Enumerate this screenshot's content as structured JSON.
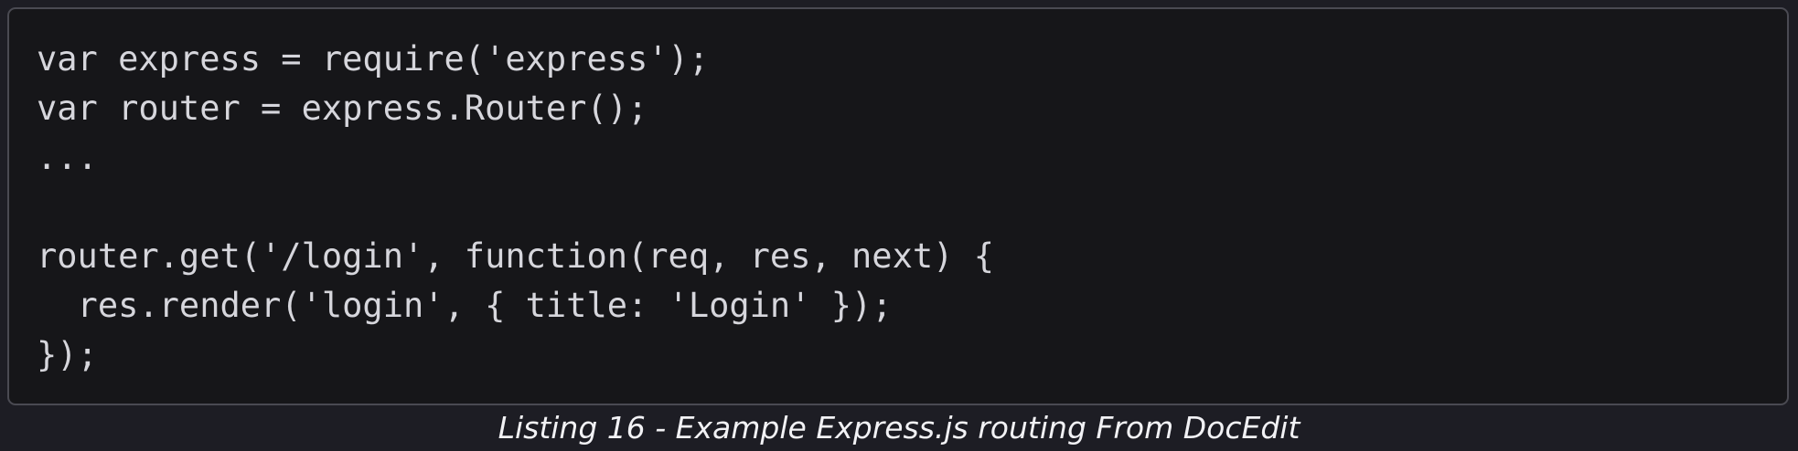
{
  "code": {
    "lines": [
      "var express = require('express');",
      "var router = express.Router();",
      "...",
      "",
      "router.get('/login', function(req, res, next) {",
      "  res.render('login', { title: 'Login' });",
      "});"
    ]
  },
  "caption": {
    "text": "Listing 16 - Example Express.js routing From DocEdit"
  },
  "colors": {
    "page_background": "#1d1d24",
    "code_background": "#161619",
    "code_border": "#4a4a52",
    "code_text": "#d6d6dc",
    "caption_text": "#f2f2f5"
  }
}
